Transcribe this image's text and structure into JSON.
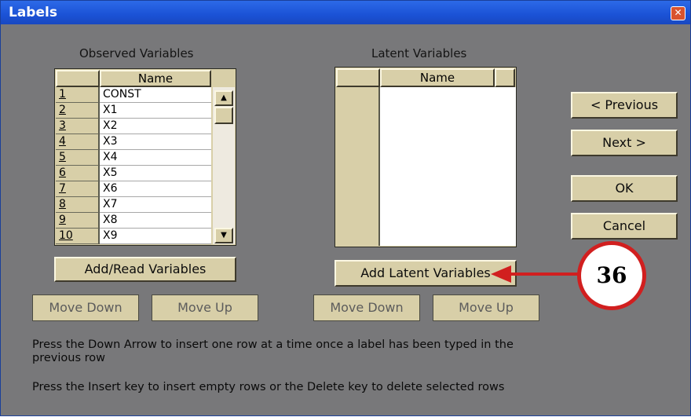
{
  "window": {
    "title": "Labels",
    "close_icon": "close-icon"
  },
  "observed": {
    "label": "Observed Variables",
    "header": "Name",
    "rows": [
      {
        "num": "1",
        "name": "CONST"
      },
      {
        "num": "2",
        "name": "X1"
      },
      {
        "num": "3",
        "name": "X2"
      },
      {
        "num": "4",
        "name": "X3"
      },
      {
        "num": "5",
        "name": "X4"
      },
      {
        "num": "6",
        "name": "X5"
      },
      {
        "num": "7",
        "name": "X6"
      },
      {
        "num": "8",
        "name": "X7"
      },
      {
        "num": "9",
        "name": "X8"
      },
      {
        "num": "10",
        "name": "X9"
      }
    ],
    "add_button": "Add/Read Variables",
    "move_down": "Move Down",
    "move_up": "Move Up"
  },
  "latent": {
    "label": "Latent Variables",
    "header": "Name",
    "add_button": "Add Latent Variables",
    "move_down": "Move Down",
    "move_up": "Move Up"
  },
  "nav": {
    "previous": "< Previous",
    "next": "Next >",
    "ok": "OK",
    "cancel": "Cancel"
  },
  "hints": {
    "line1": "Press the Down Arrow to insert one row at a time once a label has been typed in the",
    "line1b": "previous row",
    "line2": "Press the Insert key to insert empty rows or the Delete key to delete selected rows"
  },
  "annotation": {
    "number": "36",
    "color": "#d11f1f"
  }
}
